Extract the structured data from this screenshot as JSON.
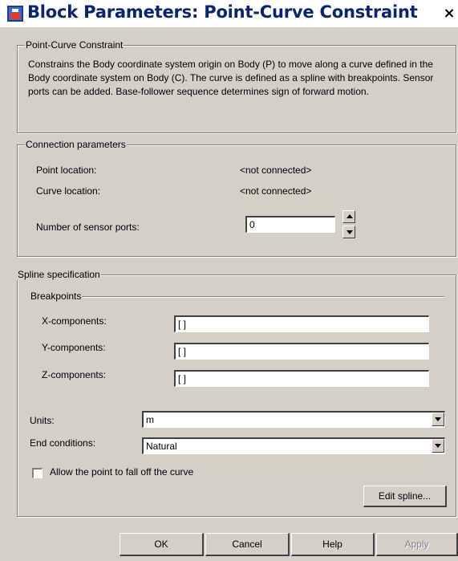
{
  "window": {
    "title": "Block Parameters: Point-Curve Constraint",
    "close_glyph": "×"
  },
  "description_group": {
    "legend": "Point-Curve Constraint",
    "text": "Constrains the Body coordinate system origin on Body (P) to move along a curve defined in the Body coordinate system on Body (C). The curve is defined as a spline with breakpoints. Sensor ports can be added. Base-follower sequence determines sign of forward motion."
  },
  "connection": {
    "legend": "Connection parameters",
    "point_location_label": "Point location:",
    "point_location_value": "<not connected>",
    "curve_location_label": "Curve location:",
    "curve_location_value": "<not connected>",
    "sensor_ports_label": "Number of sensor ports:",
    "sensor_ports_value": "0"
  },
  "spline": {
    "legend": "Spline specification",
    "breakpoints_label": "Breakpoints",
    "x_label": "X-components:",
    "x_value": "[ ]",
    "y_label": "Y-components:",
    "y_value": "[ ]",
    "z_label": "Z-components:",
    "z_value": "[ ]",
    "units_label": "Units:",
    "units_value": "m",
    "end_conditions_label": "End conditions:",
    "end_conditions_value": "Natural",
    "allow_falloff_label": "Allow the point to fall off the curve",
    "allow_falloff_checked": false,
    "edit_spline_label": "Edit spline..."
  },
  "footer": {
    "ok_label": "OK",
    "cancel_label": "Cancel",
    "help_label": "Help",
    "apply_label": "Apply"
  },
  "colors": {
    "dialog_bg": "#d4d0c8",
    "title_text": "#0a246a"
  }
}
